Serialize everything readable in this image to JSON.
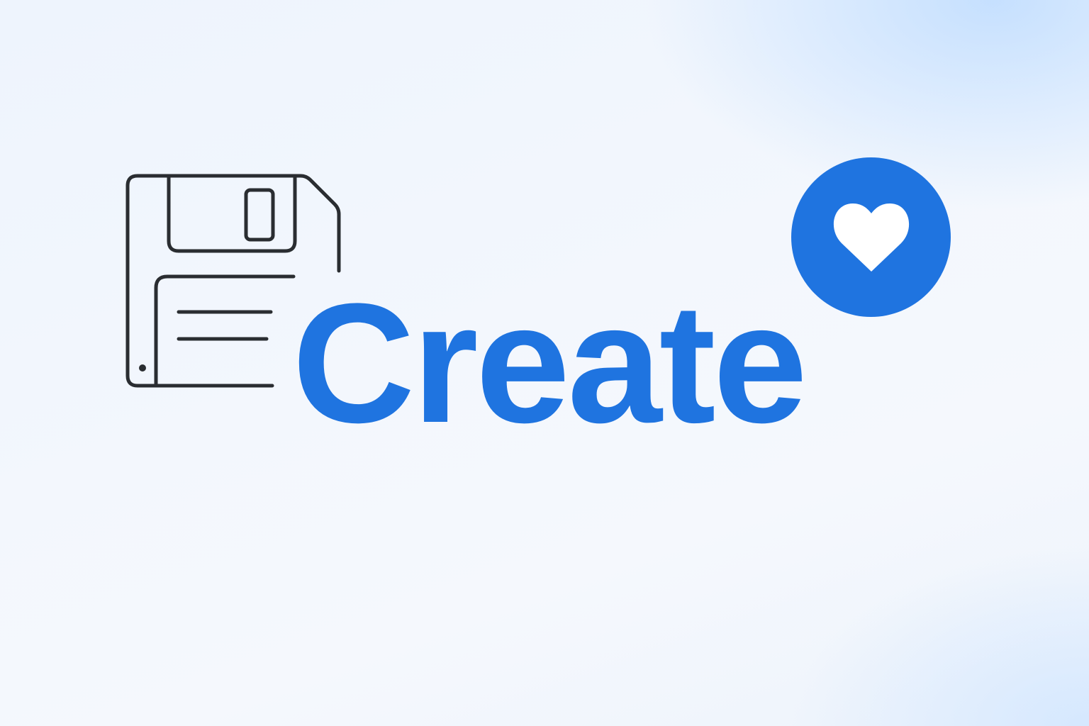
{
  "title": "Create",
  "icons": {
    "left": "floppy-disk-save-icon",
    "right": "heart-icon"
  },
  "colors": {
    "accent": "#1f74e0",
    "icon_stroke": "#2a2d31",
    "heart_fill": "#ffffff"
  }
}
